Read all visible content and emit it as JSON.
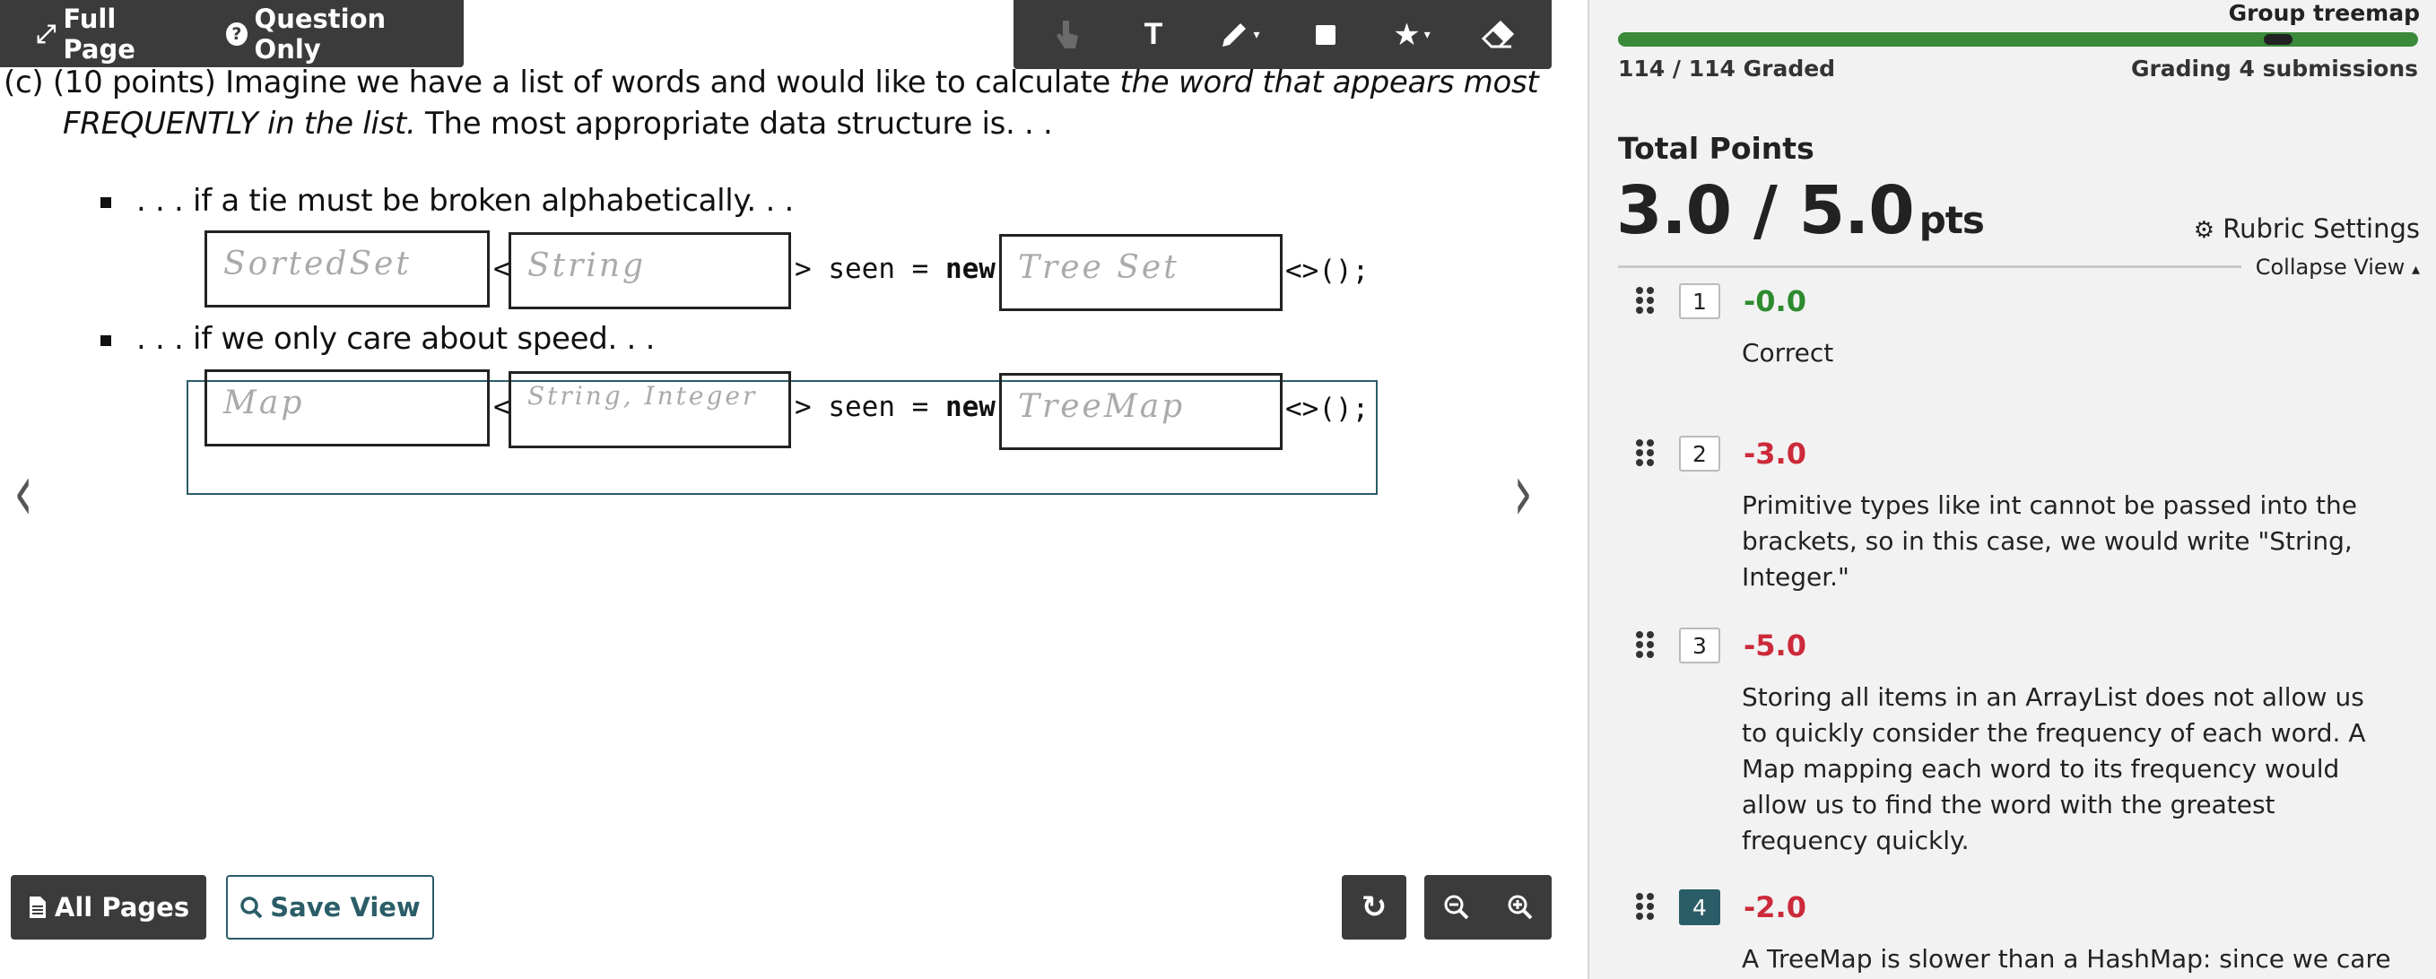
{
  "viewer": {
    "full_page_label": "Full Page",
    "question_only_label": "Question Only",
    "all_pages_label": "All Pages",
    "save_view_label": "Save View"
  },
  "question": {
    "line1_prefix": "(c)  (10 points) Imagine we have a list of words and would like to calculate ",
    "line1_italic": "the word that appears most",
    "line2_italic": "FREQUENTLY in the list.",
    "line2_rest": " The most appropriate data structure is. . .",
    "bullet1": ". . . if a tie must be broken alphabetically. . .",
    "bullet2": ". . . if we only care about speed. . .",
    "lt": "<",
    "seen_new_pre": "> seen = ",
    "new_kw": "new",
    "tail": "<>();",
    "answer1_type": "SortedSet",
    "answer1_generic": "String",
    "answer1_impl": "Tree Set",
    "answer2_type": "Map",
    "answer2_generic": "String, Integer",
    "answer2_impl": "TreeMap"
  },
  "panel": {
    "group_title": "Group treemap",
    "graded_count": "114 / 114 Graded",
    "grading_submissions": "Grading 4 submissions",
    "progress_fraction": 1.0,
    "total_label": "Total Points",
    "total_score": "3.0 / 5.0",
    "total_unit": "pts",
    "rubric_settings_label": "Rubric Settings",
    "collapse_view_label": "Collapse View"
  },
  "rubric": [
    {
      "key": "1",
      "points": "-0.0",
      "selected": false,
      "description": "Correct"
    },
    {
      "key": "2",
      "points": "-3.0",
      "selected": false,
      "description": "Primitive types like int cannot be passed into the brackets, so in this case, we would write \"String, Integer.\""
    },
    {
      "key": "3",
      "points": "-5.0",
      "selected": false,
      "description": "Storing all items in an ArrayList does not allow us to quickly consider the frequency of each word. A Map mapping each word to its frequency would allow us to find the word with the greatest frequency quickly."
    },
    {
      "key": "4",
      "points": "-2.0",
      "selected": true,
      "description": "A TreeMap is slower than a HashMap: since we care only"
    }
  ],
  "colors": {
    "toolbar_dark": "#3b3b3b",
    "accent_teal": "#2a5d67",
    "progress_green": "#3a8a3a",
    "positive_points": "#2e8b2e",
    "negative_points": "#cc2a3a"
  },
  "icons": {
    "full_page": "expand-icon",
    "question_only": "question-circle-icon",
    "all_pages": "file-icon",
    "save_view": "search-icon",
    "tools": [
      "pointer-icon",
      "text-icon",
      "pen-icon",
      "box-icon",
      "star-icon",
      "eraser-icon"
    ],
    "bottom_right": [
      "refresh-icon",
      "zoom-out-icon",
      "zoom-in-icon"
    ],
    "rubric_settings": "gear-icon",
    "collapse": "caret-up-icon"
  }
}
